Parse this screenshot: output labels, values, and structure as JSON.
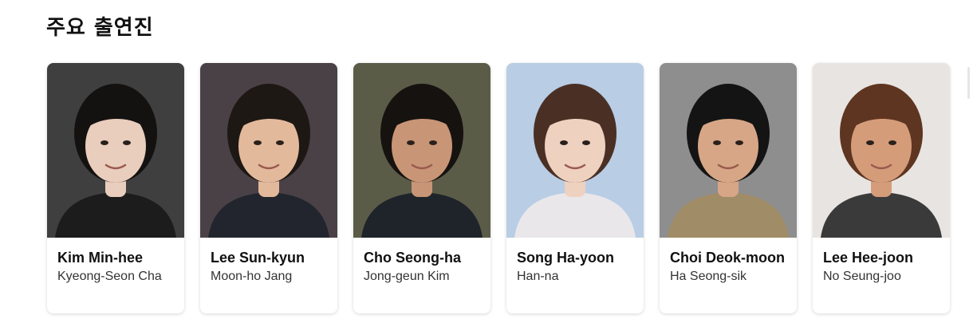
{
  "section": {
    "title": "주요 출연진"
  },
  "cast": [
    {
      "name": "Kim Min-hee",
      "role": "Kyeong-Seon Cha",
      "photo_bg": "#3f3f40",
      "hair": "#141210",
      "skin": "#e9cdbd",
      "shirt": "#1c1c1c"
    },
    {
      "name": "Lee Sun-kyun",
      "role": "Moon-ho Jang",
      "photo_bg": "#4a4147",
      "hair": "#1e1814",
      "skin": "#e3b99c",
      "shirt": "#22252d"
    },
    {
      "name": "Cho Seong-ha",
      "role": "Jong-geun Kim",
      "photo_bg": "#5b5c48",
      "hair": "#16120f",
      "skin": "#c89577",
      "shirt": "#1e2429"
    },
    {
      "name": "Song Ha-yoon",
      "role": "Han-na",
      "photo_bg": "#b9cde5",
      "hair": "#4a3024",
      "skin": "#efd1c0",
      "shirt": "#e9e7ea"
    },
    {
      "name": "Choi Deok-moon",
      "role": "Ha Seong-sik",
      "photo_bg": "#8e8e8f",
      "hair": "#141414",
      "skin": "#d7a686",
      "shirt": "#a08c66"
    },
    {
      "name": "Lee Hee-joon",
      "role": "No Seung-joo",
      "photo_bg": "#e8e4e1",
      "hair": "#5e3520",
      "skin": "#d59c7a",
      "shirt": "#3a3a3a"
    }
  ]
}
